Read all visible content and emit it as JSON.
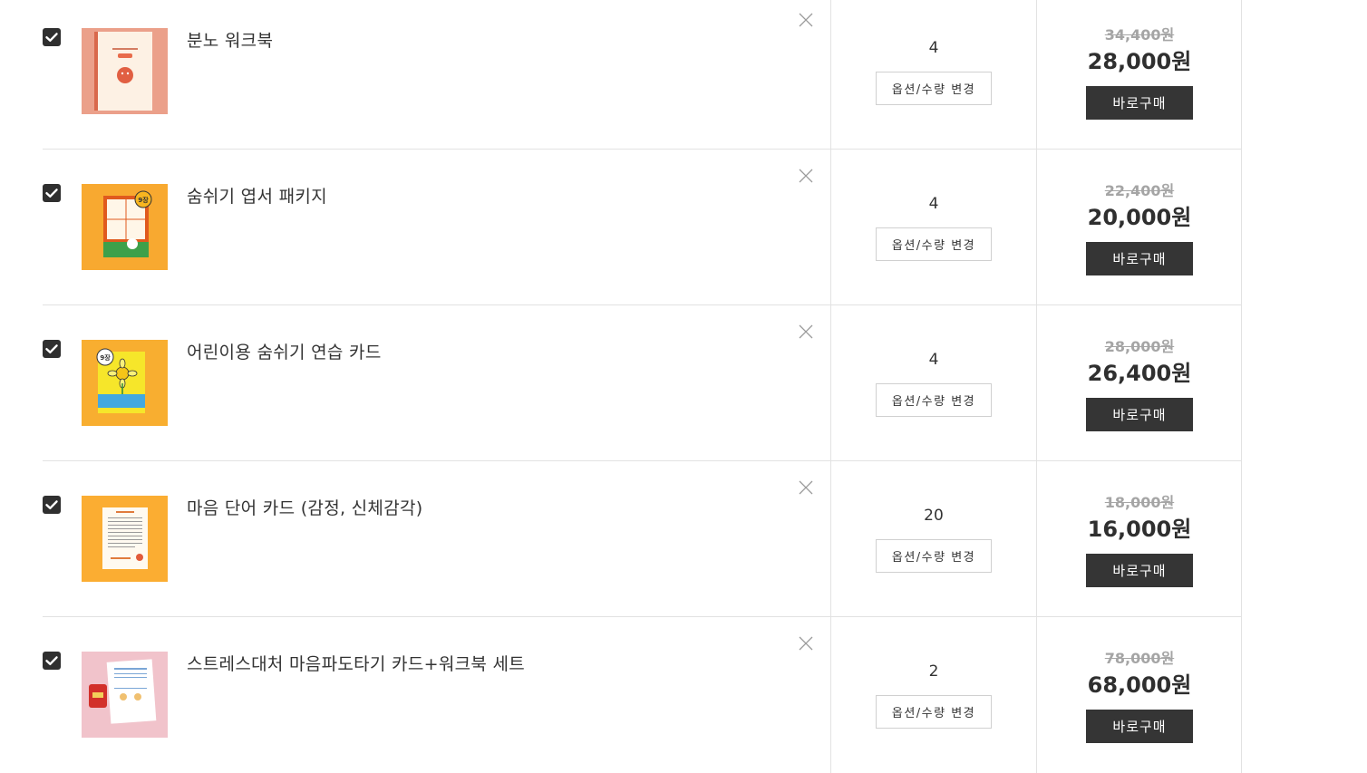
{
  "cart": {
    "option_button_label": "옵션/수량 변경",
    "buy_button_label": "바로구매",
    "items": [
      {
        "name": "분노 워크북",
        "quantity": "4",
        "original_price": "34,400원",
        "price": "28,000원",
        "checked": true,
        "thumb_bg": "#eba08a"
      },
      {
        "name": "숨쉬기 엽서 패키지",
        "quantity": "4",
        "original_price": "22,400원",
        "price": "20,000원",
        "checked": true,
        "thumb_bg": "#f8a930"
      },
      {
        "name": "어린이용 숨쉬기 연습 카드",
        "quantity": "4",
        "original_price": "28,000원",
        "price": "26,400원",
        "checked": true,
        "thumb_bg": "#f8ae30"
      },
      {
        "name": "마음 단어 카드 (감정, 신체감각)",
        "quantity": "20",
        "original_price": "18,000원",
        "price": "16,000원",
        "checked": true,
        "thumb_bg": "#fbad32"
      },
      {
        "name": "스트레스대처 마음파도타기 카드+워크북 세트",
        "quantity": "2",
        "original_price": "78,000원",
        "price": "68,000원",
        "checked": true,
        "thumb_bg": "#f1c3cb"
      }
    ]
  },
  "colors": {
    "checkbox": "#2f2f2f",
    "buy_button": "#353535",
    "divider": "#e2e2e2",
    "old_price": "#a5a5a5"
  },
  "icons": {
    "checkbox": "check-icon",
    "remove": "close-icon"
  }
}
